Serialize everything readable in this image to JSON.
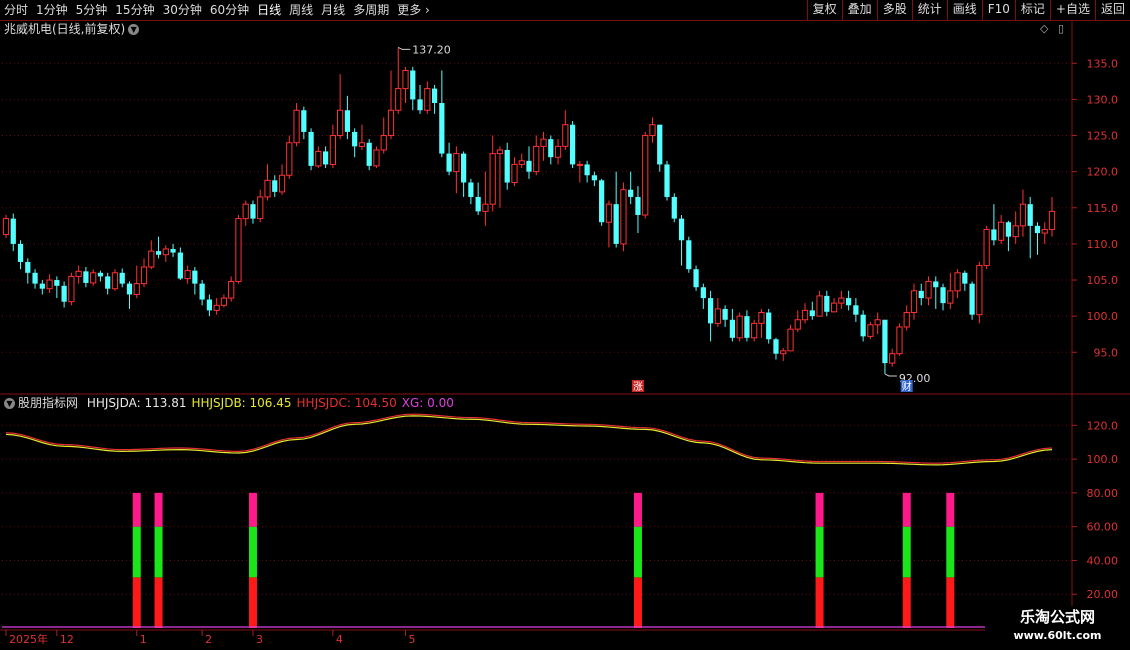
{
  "toolbar": {
    "periods": [
      "分时",
      "1分钟",
      "5分钟",
      "15分钟",
      "30分钟",
      "60分钟",
      "日线",
      "周线",
      "月线",
      "多周期",
      "更多"
    ],
    "active": "日线",
    "buttons": [
      "复权",
      "叠加",
      "多股",
      "统计",
      "画线",
      "F10",
      "标记",
      "+自选",
      "返回"
    ]
  },
  "stock": {
    "title": "兆威机电(日线,前复权)"
  },
  "price_panel": {
    "y_ticks": [
      135.0,
      130.0,
      125.0,
      120.0,
      115.0,
      110.0,
      105.0,
      100.0,
      95.0
    ],
    "high_label": "137.20",
    "low_label": "92.00",
    "event_labels": [
      {
        "text": "涨",
        "color": "#cc2222"
      },
      {
        "text": "财",
        "color": "#3366cc"
      }
    ]
  },
  "indicator": {
    "name": "股朋指标网",
    "legend": [
      {
        "text": "HHJSJDA: 113.81",
        "color": "#e8e8e8"
      },
      {
        "text": "HHJSJDB: 106.45",
        "color": "#e8e830"
      },
      {
        "text": "HHJSJDC: 104.50",
        "color": "#e83030"
      },
      {
        "text": "XG: 0.00",
        "color": "#e040e0"
      }
    ],
    "y_ticks": [
      120.0,
      100.0,
      80.0,
      60.0,
      40.0,
      20.0
    ]
  },
  "x_axis": {
    "labels": [
      {
        "text": "2025年",
        "i": 0
      },
      {
        "text": "12",
        "i": 7
      },
      {
        "text": "1",
        "i": 18
      },
      {
        "text": "2",
        "i": 27
      },
      {
        "text": "3",
        "i": 34
      },
      {
        "text": "4",
        "i": 45
      },
      {
        "text": "5",
        "i": 55
      }
    ]
  },
  "watermark": {
    "line1": "乐淘公式网",
    "line2": "www.60lt.com"
  },
  "chart_data": {
    "type": "candlestick",
    "price_range": [
      89.5,
      138.5
    ],
    "candles": [
      [
        111.3,
        113.5,
        114.0,
        110.8
      ],
      [
        113.5,
        110.0,
        114.2,
        109.0
      ],
      [
        110.0,
        107.5,
        110.5,
        106.5
      ],
      [
        107.5,
        106.0,
        108.0,
        104.5
      ],
      [
        106.0,
        104.5,
        106.5,
        103.8
      ],
      [
        104.5,
        103.8,
        105.0,
        103.0
      ],
      [
        103.8,
        105.0,
        105.8,
        103.2
      ],
      [
        105.0,
        104.2,
        105.5,
        102.5
      ],
      [
        104.2,
        102.0,
        104.8,
        101.2
      ],
      [
        102.0,
        105.5,
        106.0,
        101.5
      ],
      [
        105.5,
        106.2,
        107.0,
        104.5
      ],
      [
        106.2,
        104.6,
        106.8,
        104.0
      ],
      [
        104.6,
        106.0,
        106.5,
        104.2
      ],
      [
        106.0,
        105.5,
        106.3,
        104.8
      ],
      [
        105.5,
        103.8,
        106.0,
        103.0
      ],
      [
        103.8,
        106.0,
        106.5,
        103.5
      ],
      [
        106.0,
        104.5,
        106.6,
        104.0
      ],
      [
        104.5,
        103.0,
        104.8,
        101.0
      ],
      [
        103.0,
        104.5,
        107.0,
        102.5
      ],
      [
        104.5,
        106.8,
        108.0,
        104.0
      ],
      [
        106.8,
        109.0,
        110.5,
        106.5
      ],
      [
        109.0,
        108.5,
        111.0,
        108.0
      ],
      [
        108.5,
        109.3,
        109.8,
        107.5
      ],
      [
        109.3,
        108.8,
        110.0,
        108.2
      ],
      [
        108.8,
        105.2,
        109.5,
        105.0
      ],
      [
        105.2,
        106.3,
        107.0,
        104.5
      ],
      [
        106.3,
        104.5,
        106.8,
        103.0
      ],
      [
        104.5,
        102.3,
        105.0,
        101.5
      ],
      [
        102.3,
        100.8,
        103.0,
        100.0
      ],
      [
        100.8,
        101.5,
        102.5,
        100.2
      ],
      [
        101.5,
        102.5,
        103.0,
        101.2
      ],
      [
        102.5,
        104.8,
        105.5,
        102.0
      ],
      [
        104.8,
        113.5,
        114.0,
        104.5
      ],
      [
        113.5,
        115.5,
        116.0,
        112.5
      ],
      [
        115.5,
        113.5,
        116.0,
        112.8
      ],
      [
        113.5,
        116.5,
        117.5,
        113.0
      ],
      [
        116.5,
        118.8,
        121.0,
        116.0
      ],
      [
        118.8,
        117.2,
        119.5,
        116.5
      ],
      [
        117.2,
        119.5,
        121.0,
        116.8
      ],
      [
        119.5,
        124.0,
        125.0,
        119.0
      ],
      [
        124.0,
        128.5,
        129.5,
        123.5
      ],
      [
        128.5,
        125.5,
        129.0,
        124.5
      ],
      [
        125.5,
        120.8,
        126.0,
        120.2
      ],
      [
        120.8,
        122.8,
        123.5,
        120.5
      ],
      [
        122.8,
        121.0,
        123.5,
        120.5
      ],
      [
        121.0,
        125.0,
        126.5,
        120.5
      ],
      [
        125.0,
        128.5,
        133.5,
        124.5
      ],
      [
        128.5,
        125.5,
        130.5,
        124.5
      ],
      [
        125.5,
        123.5,
        126.0,
        122.0
      ],
      [
        123.5,
        124.0,
        126.5,
        123.0
      ],
      [
        124.0,
        120.8,
        124.5,
        120.2
      ],
      [
        120.8,
        123.0,
        123.5,
        120.5
      ],
      [
        123.0,
        125.0,
        127.5,
        122.5
      ],
      [
        125.0,
        128.5,
        134.0,
        124.5
      ],
      [
        128.5,
        131.5,
        137.2,
        128.0
      ],
      [
        131.5,
        134.0,
        134.5,
        129.5
      ],
      [
        134.0,
        130.0,
        134.5,
        128.5
      ],
      [
        130.0,
        128.5,
        132.0,
        128.0
      ],
      [
        128.5,
        131.5,
        132.5,
        128.0
      ],
      [
        131.5,
        129.5,
        132.0,
        128.0
      ],
      [
        129.5,
        122.5,
        134.0,
        122.0
      ],
      [
        122.5,
        120.0,
        124.0,
        119.5
      ],
      [
        120.0,
        122.5,
        123.5,
        117.0
      ],
      [
        122.5,
        118.5,
        122.8,
        116.5
      ],
      [
        118.5,
        116.5,
        119.0,
        115.5
      ],
      [
        116.5,
        114.5,
        118.5,
        114.0
      ],
      [
        114.5,
        115.5,
        120.0,
        112.5
      ],
      [
        115.5,
        122.5,
        125.0,
        114.5
      ],
      [
        122.5,
        123.0,
        123.5,
        115.0
      ],
      [
        123.0,
        118.5,
        124.0,
        117.5
      ],
      [
        118.5,
        121.0,
        122.0,
        118.0
      ],
      [
        121.0,
        121.5,
        122.5,
        120.5
      ],
      [
        121.5,
        120.0,
        123.5,
        119.0
      ],
      [
        120.0,
        123.5,
        125.0,
        119.5
      ],
      [
        123.5,
        124.5,
        125.5,
        121.5
      ],
      [
        124.5,
        122.0,
        125.0,
        121.0
      ],
      [
        122.0,
        123.5,
        124.5,
        121.0
      ],
      [
        123.5,
        126.5,
        128.5,
        123.0
      ],
      [
        126.5,
        121.0,
        127.0,
        120.5
      ],
      [
        121.0,
        121.0,
        121.5,
        118.5
      ],
      [
        121.0,
        119.5,
        121.5,
        118.5
      ],
      [
        119.5,
        118.8,
        120.0,
        118.0
      ],
      [
        118.8,
        113.0,
        119.0,
        112.5
      ],
      [
        113.0,
        115.5,
        116.0,
        109.5
      ],
      [
        115.5,
        110.0,
        120.0,
        109.5
      ],
      [
        110.0,
        117.5,
        118.5,
        109.0
      ],
      [
        117.5,
        116.5,
        120.0,
        115.5
      ],
      [
        116.5,
        114.0,
        118.0,
        111.5
      ],
      [
        114.0,
        125.0,
        125.5,
        113.5
      ],
      [
        125.0,
        126.5,
        127.5,
        124.0
      ],
      [
        126.5,
        121.0,
        126.5,
        120.0
      ],
      [
        121.0,
        116.5,
        121.5,
        116.0
      ],
      [
        116.5,
        113.5,
        117.0,
        113.0
      ],
      [
        113.5,
        110.5,
        114.0,
        107.0
      ],
      [
        110.5,
        106.5,
        111.0,
        106.0
      ],
      [
        106.5,
        104.0,
        107.0,
        103.5
      ],
      [
        104.0,
        102.5,
        104.5,
        101.0
      ],
      [
        102.5,
        99.0,
        103.5,
        96.5
      ],
      [
        99.0,
        101.0,
        102.5,
        98.5
      ],
      [
        101.0,
        99.5,
        101.5,
        98.5
      ],
      [
        99.5,
        97.0,
        101.0,
        96.5
      ],
      [
        97.0,
        100.0,
        100.5,
        96.5
      ],
      [
        100.0,
        97.0,
        100.8,
        96.5
      ],
      [
        97.0,
        99.0,
        99.5,
        96.5
      ],
      [
        99.0,
        100.5,
        101.0,
        97.0
      ],
      [
        100.5,
        96.8,
        101.0,
        96.2
      ],
      [
        96.8,
        94.8,
        97.0,
        94.0
      ],
      [
        94.8,
        95.2,
        95.6,
        93.8
      ],
      [
        95.2,
        98.2,
        98.8,
        97.5
      ],
      [
        98.2,
        99.5,
        100.8,
        97.8
      ],
      [
        99.5,
        100.8,
        101.8,
        99.0
      ],
      [
        100.8,
        100.0,
        102.0,
        99.5
      ],
      [
        100.0,
        102.8,
        103.5,
        100.5
      ],
      [
        102.8,
        100.6,
        103.5,
        100.0
      ],
      [
        100.6,
        101.8,
        102.5,
        100.5
      ],
      [
        101.8,
        102.5,
        103.5,
        101.0
      ],
      [
        102.5,
        101.5,
        103.5,
        100.8
      ],
      [
        101.5,
        100.2,
        102.5,
        99.2
      ],
      [
        100.2,
        97.2,
        100.8,
        96.5
      ],
      [
        97.2,
        98.8,
        99.2,
        96.8
      ],
      [
        98.8,
        99.5,
        100.5,
        97.5
      ],
      [
        99.5,
        93.5,
        99.5,
        92.0
      ],
      [
        93.5,
        94.8,
        95.5,
        93.0
      ],
      [
        94.8,
        98.5,
        99.0,
        94.5
      ],
      [
        98.5,
        100.5,
        101.5,
        98.0
      ],
      [
        100.5,
        103.5,
        104.5,
        99.5
      ],
      [
        103.5,
        102.5,
        104.5,
        101.5
      ],
      [
        102.5,
        104.8,
        105.5,
        101.5
      ],
      [
        104.8,
        104.0,
        105.5,
        101.0
      ],
      [
        104.0,
        101.8,
        104.5,
        100.8
      ],
      [
        101.8,
        103.5,
        106.0,
        101.0
      ],
      [
        103.5,
        106.0,
        106.5,
        102.5
      ],
      [
        106.0,
        104.5,
        106.3,
        103.5
      ],
      [
        104.5,
        100.2,
        104.8,
        99.5
      ],
      [
        100.2,
        107.0,
        107.5,
        99.0
      ],
      [
        107.0,
        112.0,
        112.5,
        106.5
      ],
      [
        112.0,
        110.5,
        115.5,
        109.8
      ],
      [
        110.5,
        113.0,
        114.0,
        110.0
      ],
      [
        113.0,
        111.0,
        113.2,
        109.0
      ],
      [
        111.0,
        112.5,
        114.5,
        110.0
      ],
      [
        112.5,
        115.5,
        117.5,
        111.0
      ],
      [
        115.5,
        112.5,
        116.5,
        108.0
      ],
      [
        112.5,
        111.5,
        113.0,
        108.5
      ],
      [
        111.5,
        112.0,
        113.0,
        110.0
      ],
      [
        112.0,
        114.5,
        116.5,
        111.0
      ]
    ],
    "indicator_series": [
      {
        "name": "HHJSJDA",
        "color": "#e8e8e8",
        "last": 113.81
      },
      {
        "name": "HHJSJDB",
        "color": "#e8e830",
        "last": 106.45
      },
      {
        "name": "HHJSJDC",
        "color": "#e83030",
        "last": 104.5
      }
    ],
    "indicator_curve": [
      [
        0,
        115
      ],
      [
        8,
        108
      ],
      [
        16,
        105
      ],
      [
        24,
        106
      ],
      [
        32,
        104
      ],
      [
        40,
        112
      ],
      [
        48,
        121
      ],
      [
        56,
        126
      ],
      [
        64,
        124
      ],
      [
        72,
        121
      ],
      [
        80,
        120
      ],
      [
        88,
        118
      ],
      [
        96,
        110
      ],
      [
        104,
        100
      ],
      [
        112,
        98
      ],
      [
        120,
        98
      ],
      [
        128,
        97
      ],
      [
        136,
        99
      ],
      [
        144,
        106
      ]
    ],
    "signal_bars": {
      "indices": [
        18,
        21,
        34,
        87,
        112,
        124,
        130
      ],
      "segments": [
        {
          "from": 0,
          "to": 30,
          "color": "#ff1a1a"
        },
        {
          "from": 30,
          "to": 60,
          "color": "#1ae61a"
        },
        {
          "from": 60,
          "to": 80,
          "color": "#ff1a8c"
        }
      ]
    },
    "indicator_range": [
      0,
      135
    ]
  }
}
